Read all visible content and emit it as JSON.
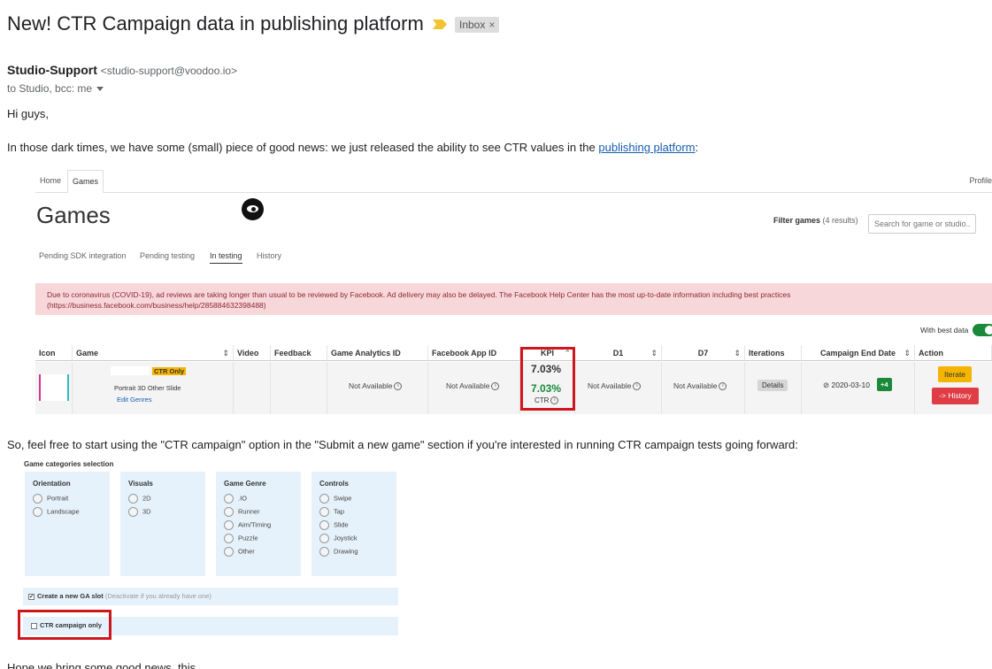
{
  "email": {
    "subject": "New! CTR Campaign data in publishing platform",
    "label_chip": "Inbox",
    "label_close": "×",
    "sender_name": "Studio-Support",
    "sender_email": "<studio-support@voodoo.io>",
    "recipients": "to Studio, bcc: me",
    "greeting": "Hi guys,",
    "para1_before": "In those dark times, we have some (small) piece of good news: we just released the ability to see CTR values in the ",
    "para1_link": "publishing platform",
    "para1_after": ":",
    "para2": "So, feel free to start using the \"CTR campaign\" option in the \"Submit a new game\" section if you're interested in running CTR campaign tests going forward:",
    "para3": "Hope we bring some good news, this"
  },
  "platform": {
    "nav_tabs": [
      "Home",
      "Games"
    ],
    "profile": "Profile",
    "page_title": "Games",
    "filter_label": "Filter games",
    "filter_count": "(4 results)",
    "search_placeholder": "Search for game or studio...",
    "sub_tabs": [
      "Pending SDK integration",
      "Pending testing",
      "In testing",
      "History"
    ],
    "active_sub_tab": "In testing",
    "alert_line1": "Due to coronavirus (COVID-19), ad reviews are taking longer than usual to be reviewed by Facebook. Ad delivery may also be delayed. The Facebook Help Center has the most up-to-date information including best practices",
    "alert_line2": "(https://business.facebook.com/business/help/285884632398488)",
    "best_data_label": "With best data",
    "best_data_on": true,
    "columns": [
      "Icon",
      "Game",
      "Video",
      "Feedback",
      "Game Analytics ID",
      "Facebook App ID",
      "KPI",
      "D1",
      "D7",
      "Iterations",
      "Campaign End Date",
      "Action"
    ],
    "sort_icon": "⌃",
    "row": {
      "ctr_badge": "CTR Only",
      "genres": "Portrait  3D  Other  Slide",
      "edit_genres": "Edit Genres",
      "ga_id": "Not Available",
      "fb_app_id": "Not Available",
      "kpi_value": "7.03%",
      "ctr_value": "7.03%",
      "ctr_label": "CTR",
      "d1": "Not Available",
      "d7": "Not Available",
      "details_btn": "Details",
      "end_date": "2020-03-10",
      "extra_iterations": "+4",
      "iterate_btn": "Iterate",
      "history_btn": "-> History"
    }
  },
  "form": {
    "title": "Game categories selection",
    "groups": [
      {
        "heading": "Orientation",
        "options": [
          "Portrait",
          "Landscape"
        ]
      },
      {
        "heading": "Visuals",
        "options": [
          "2D",
          "3D"
        ]
      },
      {
        "heading": "Game Genre",
        "options": [
          ".IO",
          "Runner",
          "Aim/Timing",
          "Puzzle",
          "Other"
        ]
      },
      {
        "heading": "Controls",
        "options": [
          "Swipe",
          "Tap",
          "Slide",
          "Joystick",
          "Drawing"
        ]
      }
    ],
    "ga_slot_label": "Create a new GA slot",
    "ga_slot_hint": "(Deactivate if you already have one)",
    "ga_slot_checked": true,
    "ctr_only_label": "CTR campaign only",
    "ctr_only_checked": false
  },
  "colors": {
    "highlight": "#d0161d",
    "kpi_green": "#1a8a3a",
    "alert_bg": "#f8d7da",
    "form_bg": "#e6f2fb",
    "iterate": "#f5b400",
    "history": "#e03c45",
    "link": "#1a5dad"
  }
}
